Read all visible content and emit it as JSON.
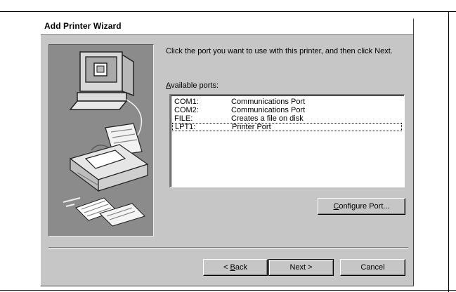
{
  "window": {
    "title": "Add Printer Wizard"
  },
  "instruction": "Click the port you want to use with this printer, and then click Next.",
  "ports": {
    "label_hotkey": "A",
    "label_rest": "vailable ports:",
    "items": [
      {
        "name": "COM1:",
        "description": "Communications Port",
        "selected": false
      },
      {
        "name": "COM2:",
        "description": "Communications Port",
        "selected": false
      },
      {
        "name": "FILE:",
        "description": "Creates a file on disk",
        "selected": false
      },
      {
        "name": "LPT1:",
        "description": "Printer Port",
        "selected": true
      }
    ]
  },
  "buttons": {
    "configure": {
      "hotkey": "C",
      "rest": "onfigure Port..."
    },
    "back": {
      "prefix": "< ",
      "hotkey": "B",
      "rest": "ack"
    },
    "next": "Next >",
    "cancel": "Cancel"
  },
  "illustration": {
    "icons": [
      "monitor-icon",
      "printer-icon",
      "documents-icon"
    ],
    "colors": {
      "panel_bg": "#8b8b8b",
      "line_art": "#ffffff"
    }
  }
}
